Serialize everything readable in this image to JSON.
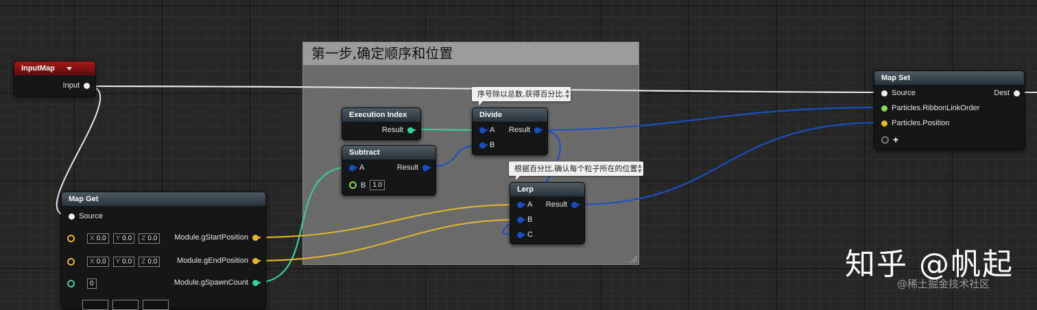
{
  "comment": {
    "title": "第一步,确定顺序和位置"
  },
  "tooltips": {
    "divide": "序号除以总数,获得百分比.",
    "lerp": "根据百分比,确认每个粒子所在的位置"
  },
  "nodes": {
    "input_map": {
      "title": "InputMap",
      "dropdown_icon": "triangle-down",
      "pin_input": "Input"
    },
    "execution_index": {
      "title": "Execution Index",
      "pin_result": "Result"
    },
    "subtract": {
      "title": "Subtract",
      "pin_a": "A",
      "pin_b": "B",
      "pin_b_value": "1.0",
      "pin_result": "Result"
    },
    "divide": {
      "title": "Divide",
      "pin_a": "A",
      "pin_b": "B",
      "pin_result": "Result"
    },
    "lerp": {
      "title": "Lerp",
      "pin_a": "A",
      "pin_b": "B",
      "pin_c": "C",
      "pin_result": "Result"
    },
    "map_get": {
      "title": "Map Get",
      "pin_source": "Source",
      "outputs": [
        {
          "label": "Module.gStartPosition",
          "x": "0.0",
          "y": "0.0",
          "z": "0.0"
        },
        {
          "label": "Module.gEndPosition",
          "x": "0.0",
          "y": "0.0",
          "z": "0.0"
        },
        {
          "label": "Module.gSpawnCount",
          "value": "0"
        }
      ],
      "axis_labels": {
        "x": "X",
        "y": "Y",
        "z": "Z"
      }
    },
    "map_set": {
      "title": "Map Set",
      "pin_source": "Source",
      "pin_dest": "Dest",
      "inputs": [
        "Particles.RibbonLinkOrder",
        "Particles.Position"
      ],
      "add_pin_icon": "+"
    }
  },
  "colors": {
    "float_pin": "#1a4fc4",
    "int_pin": "#3bd19a",
    "vector_pin": "#e8b728",
    "map_pin": "#f0f0f0",
    "order_pin": "#8fdd4b",
    "input_header": "#a81818",
    "node_header": "#3b4650"
  },
  "watermark": {
    "main": "知乎 @帆起",
    "sub": "@稀土掘金技术社区"
  }
}
